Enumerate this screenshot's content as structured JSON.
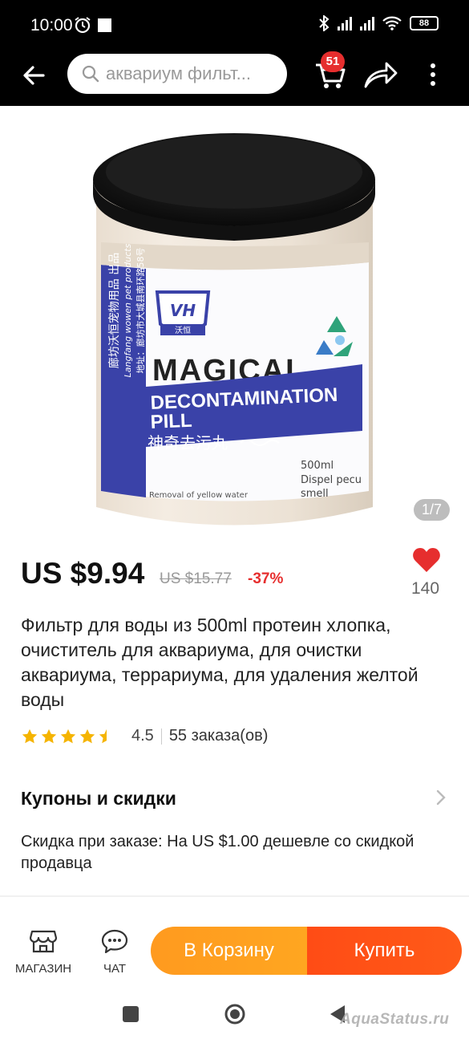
{
  "status_bar": {
    "time": "10:00",
    "battery": "88"
  },
  "header": {
    "search_text": "аквариум фильт...",
    "cart_count": "51",
    "icons": [
      "back-arrow-icon",
      "search-icon",
      "cart-icon",
      "share-icon",
      "more-icon"
    ]
  },
  "gallery": {
    "counter": "1/7",
    "image": {
      "kind": "product-photo",
      "label_lines": {
        "brand": "VH",
        "brand_cn": "沃恒",
        "title1": "MAGICAL",
        "title2": "DECONTAMINATION",
        "title3": "PILL",
        "cn_name": "神奇去污丸",
        "volume": "500ml",
        "dispel1": "Dispel pecu",
        "dispel2": "smell",
        "removal": "Removal of yellow water",
        "side1": "廊坊沃恒宠物用品 出品",
        "side2": "Langfang wowen pet products",
        "side3": "地址：廊坊市大城县南环路58号"
      }
    }
  },
  "price": {
    "current": "US $9.94",
    "old": "US $15.77",
    "discount": "-37%",
    "likes": "140"
  },
  "product": {
    "title": "Фильтр для воды из 500ml протеин хлопка, очиститель для аквариума, для очистки аквариума, террариума, для удаления желтой воды",
    "rating": "4.5",
    "rating_value": 4.5,
    "orders": "55 заказа(ов)"
  },
  "coupons": {
    "title": "Купоны и скидки",
    "text": "Скидка при заказе: На US $1.00 дешевле со скидкой продавца"
  },
  "bottom_bar": {
    "shop_label": "МАГАЗИН",
    "chat_label": "ЧАТ",
    "cart_button": "В Корзину",
    "buy_button": "Купить"
  },
  "watermark": "AquaStatus.ru",
  "colors": {
    "accent_red": "#e62e2e",
    "cart_orange": "#ff9a1f",
    "buy_orange": "#ff4c15",
    "star_gold": "#f5b400",
    "label_blue": "#3a42a8"
  }
}
